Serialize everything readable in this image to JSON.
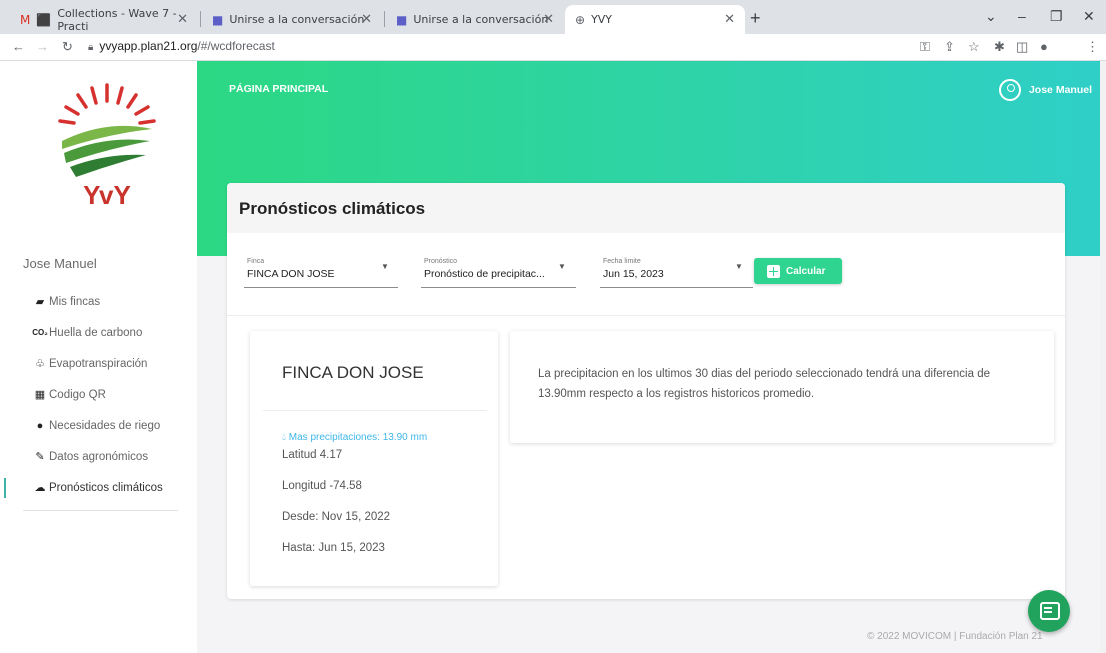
{
  "browser": {
    "tabs": [
      {
        "label": "Collections - Wave 7 - Practi",
        "icon": "gmail-icon"
      },
      {
        "label": "Unirse a la conversación",
        "icon": "teams-icon"
      },
      {
        "label": "Unirse a la conversación",
        "icon": "teams-icon"
      },
      {
        "label": "YVY",
        "icon": "globe-icon"
      }
    ],
    "url_host": "yvyapp.plan21.org",
    "url_path": "/#/wcdforecast"
  },
  "sidebar": {
    "logo_text": "YvY",
    "user_name": "Jose Manuel",
    "items": [
      {
        "label": "Mis fincas",
        "icon": "farm-icon"
      },
      {
        "label": "Huella de carbono",
        "icon": "co2-icon"
      },
      {
        "label": "Evapotranspiración",
        "icon": "plant-icon"
      },
      {
        "label": "Codigo QR",
        "icon": "qr-icon"
      },
      {
        "label": "Necesidades de riego",
        "icon": "drop-icon"
      },
      {
        "label": "Datos agronómicos",
        "icon": "feather-icon"
      },
      {
        "label": "Pronósticos climáticos",
        "icon": "cloud-icon"
      }
    ],
    "active_item": "Pronósticos climáticos"
  },
  "header": {
    "home_label": "PÁGINA PRINCIPAL",
    "user_label": "Jose Manuel"
  },
  "card": {
    "title": "Pronósticos climáticos",
    "fields": {
      "finca_label": "Finca",
      "finca_value": "FINCA DON JOSE",
      "pronostico_label": "Pronóstico",
      "pronostico_value": "Pronóstico de precipitac...",
      "fecha_label": "Fecha limite",
      "fecha_value": "Jun 15, 2023"
    },
    "calc_label": "Calcular"
  },
  "info": {
    "title": "FINCA DON JOSE",
    "alert": "Mas precipitaciones: 13.90 mm",
    "latitud": "Latitud 4.17",
    "longitud": "Longitud -74.58",
    "desde": "Desde: Nov 15, 2022",
    "hasta": "Hasta: Jun 15, 2023"
  },
  "message": "La precipitacion en los ultimos 30 dias del periodo seleccionado tendrá una diferencia de 13.90mm respecto a los registros historicos promedio.",
  "footer": "© 2022 MOVICOM | Fundación Plan 21",
  "colors": {
    "accent": "#2ed48f",
    "header_start": "#2cd883",
    "header_end": "#2fcfc8",
    "alert": "#3fb7e8"
  }
}
